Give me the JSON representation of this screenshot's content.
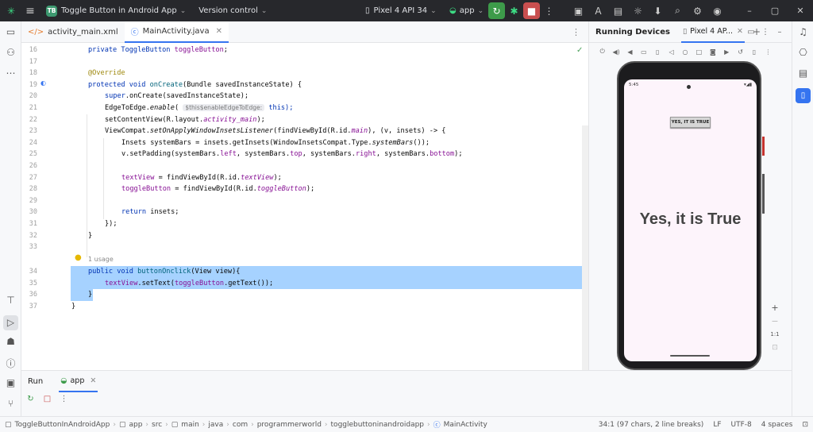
{
  "titlebar": {
    "app_icon": "android-studio-icon",
    "project_badge": "TB",
    "project_name": "Toggle Button in Android App",
    "version_control": "Version control",
    "device": "Pixel 4 API 34",
    "run_config": "app"
  },
  "tabs": [
    {
      "label": "activity_main.xml",
      "icon": "xml-icon"
    },
    {
      "label": "MainActivity.java",
      "icon": "java-class-icon",
      "active": true
    }
  ],
  "editor": {
    "line_numbers": [
      "16",
      "17",
      "18",
      "19",
      "20",
      "21",
      "22",
      "23",
      "24",
      "25",
      "26",
      "27",
      "28",
      "29",
      "30",
      "31",
      "32",
      "33",
      "34",
      "35",
      "36",
      "37"
    ],
    "usage_hint": "1 usage",
    "param_hint": "$this$enableEdgeToEdge:",
    "lines": {
      "l16a": "private ToggleButton ",
      "l16b": "toggleButton",
      "l16c": ";",
      "l18": "@Override",
      "l19a": "protected void ",
      "l19b": "onCreate",
      "l19c": "(Bundle savedInstanceState) {",
      "l20a": "super",
      "l20b": ".onCreate(savedInstanceState);",
      "l21a": "EdgeToEdge.",
      "l21b": "enable",
      "l21c": "(",
      "l21d": " this);",
      "l22a": "setContentView(R.layout.",
      "l22b": "activity_main",
      "l22c": ");",
      "l23a": "ViewCompat.",
      "l23b": "setOnApplyWindowInsetsListener",
      "l23c": "(findViewById(R.id.",
      "l23d": "main",
      "l23e": "), (v, insets) -> {",
      "l24a": "Insets systemBars = insets.getInsets(WindowInsetsCompat.Type.",
      "l24b": "systemBars",
      "l24c": "());",
      "l25a": "v.setPadding(systemBars.",
      "l25b": "left",
      "l25c": ", systemBars.",
      "l25d": "top",
      "l25e": ", systemBars.",
      "l25f": "right",
      "l25g": ", systemBars.",
      "l25h": "bottom",
      "l25i": ");",
      "l27a": "textView",
      "l27b": " = findViewById(R.id.",
      "l27c": "textView",
      "l27d": ");",
      "l28a": "toggleButton",
      "l28b": " = findViewById(R.id.",
      "l28c": "toggleButton",
      "l28d": ");",
      "l30a": "return ",
      "l30b": "insets;",
      "l31": "});",
      "l32": "}",
      "l34a": "public void ",
      "l34b": "buttonOnclick",
      "l34c": "(View view){",
      "l35a": "textView",
      "l35b": ".setText(",
      "l35c": "toggleButton",
      "l35d": ".getText());",
      "l36": "}",
      "l37": "}"
    }
  },
  "running_devices": {
    "title": "Running Devices",
    "tab": "Pixel 4 AP...",
    "phone": {
      "time": "5:45",
      "toggle_button_text": "YES, IT IS TRUE",
      "text_view": "Yes, it is True"
    },
    "zoom": {
      "plus": "+",
      "minus": "−",
      "one_to_one": "1:1"
    }
  },
  "run_panel": {
    "title": "Run",
    "tab": "app"
  },
  "statusbar": {
    "breadcrumbs": [
      "ToggleButtonInAndroidApp",
      "app",
      "src",
      "main",
      "java",
      "com",
      "programmerworld",
      "togglebuttoninandroidapp",
      "MainActivity"
    ],
    "position": "34:1 (97 chars, 2 line breaks)",
    "line_sep": "LF",
    "encoding": "UTF-8",
    "indent": "4 spaces"
  }
}
